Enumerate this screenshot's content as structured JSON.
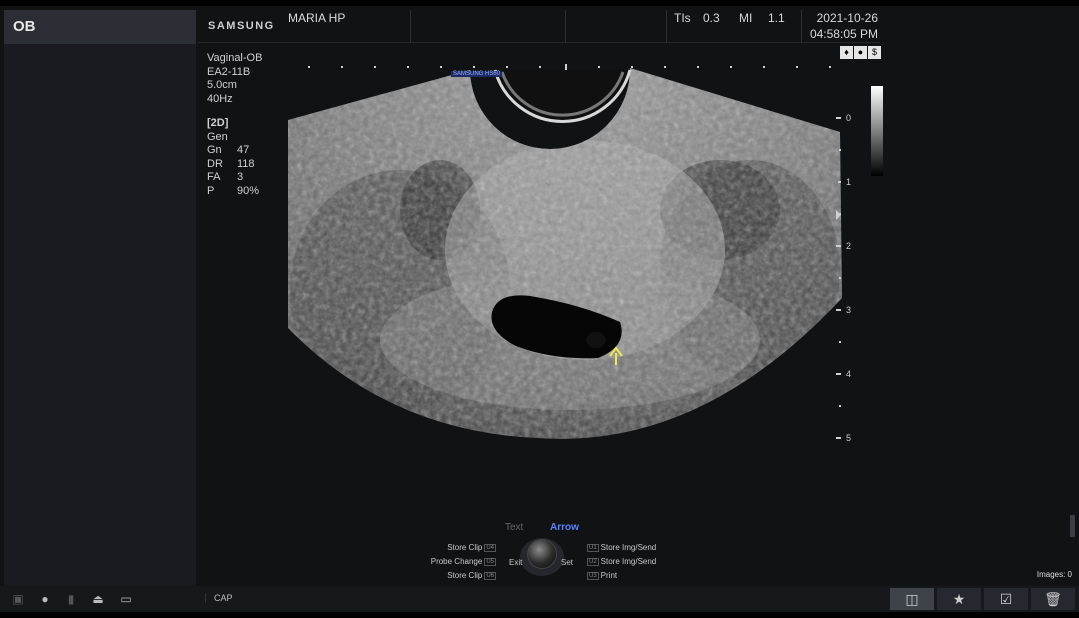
{
  "left_panel": {
    "mode": "OB"
  },
  "header": {
    "brand": "SAMSUNG",
    "patient": "MARIA HP",
    "tis_label": "TIs",
    "tis_value": "0.3",
    "mi_label": "MI",
    "mi_value": "1.1",
    "date": "2021-10-26",
    "time": "04:58:05 PM"
  },
  "probe": {
    "preset": "Vaginal-OB",
    "probe": "EA2-11B",
    "depth": "5.0cm",
    "frame_rate": "40Hz",
    "tag": "SAMSUNG HS60"
  },
  "mode_params": {
    "mode": "[2D]",
    "preset": "Gen",
    "rows": [
      {
        "label": "Gn",
        "value": "47"
      },
      {
        "label": "DR",
        "value": "118"
      },
      {
        "label": "FA",
        "value": "3"
      },
      {
        "label": "P",
        "value": "90%"
      }
    ]
  },
  "depth_scale": [
    "0",
    "1",
    "2",
    "3",
    "4",
    "5"
  ],
  "controls": {
    "tab_text": "Text",
    "tab_arrow": "Arrow",
    "left": [
      {
        "label": "Store Clip",
        "key": "U4"
      },
      {
        "label": "Probe Change",
        "key": "U5"
      },
      {
        "label": "Store Clip",
        "key": "U6"
      }
    ],
    "right": [
      {
        "label": "Store Img/Send",
        "key": "U1"
      },
      {
        "label": "Store Img/Send",
        "key": "U2"
      },
      {
        "label": "Print",
        "key": "U3"
      }
    ],
    "exit": "Exit",
    "set": "Set"
  },
  "bottom": {
    "cap": "CAP",
    "images": "Images: 0"
  },
  "colors": {
    "arrow": "#f2e94a",
    "accent": "#4f7cff"
  }
}
